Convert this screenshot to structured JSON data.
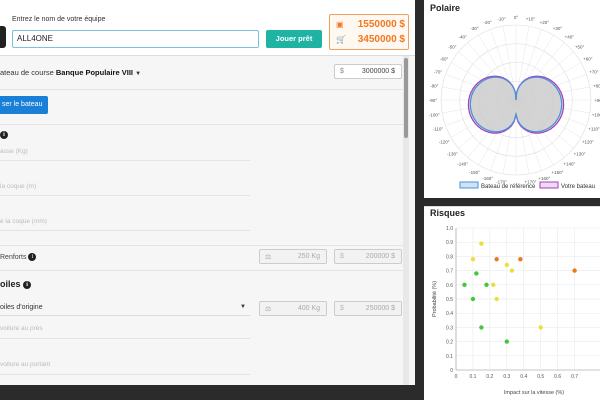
{
  "header": {
    "team_label": "Entrez le nom de votre équipe",
    "team_value": "ALL4ONE",
    "play_label": "Jouer prêt",
    "money_total": "1550000 $",
    "money_cart": "3450000 $"
  },
  "boat": {
    "label_prefix": "ateau de course",
    "label_name": "Banque Populaire VIII",
    "price_unit": "$",
    "price_value": "3000000 $",
    "use_button": "ser le bateau"
  },
  "hull": {
    "fields": [
      "asse (Kg)",
      "la coque (m)",
      "e la coque (mm)"
    ],
    "reinforcements_label": "Renforts",
    "reinforcements_weight": "250 Kg",
    "reinforcements_unit": "$",
    "reinforcements_price": "200000 $"
  },
  "sails": {
    "title": "oiles",
    "select_value": "oiles d'origine",
    "weight": "400 Kg",
    "unit": "$",
    "price": "250000 $",
    "fields": [
      "voilure au près",
      "voilure au portant"
    ]
  },
  "polar": {
    "title": "Polaire",
    "legend_reference": "Bateau de référence",
    "legend_yours": "Votre bateau",
    "angle_labels": [
      "0°",
      "+10°",
      "+20°",
      "+30°",
      "+40°",
      "+50°",
      "+60°",
      "+70°",
      "+80°",
      "+90°",
      "+100°",
      "+110°",
      "+120°",
      "+130°",
      "+140°",
      "+150°",
      "+160°",
      "+170°",
      "-10°",
      "-20°",
      "-30°",
      "-40°",
      "-50°",
      "-60°",
      "-70°",
      "-80°",
      "-90°",
      "-100°",
      "-110°",
      "-120°",
      "-130°",
      "-140°",
      "-150°",
      "-160°",
      "-170°"
    ],
    "colors": {
      "reference": "#4a90d9",
      "yours": "#a040c0"
    }
  },
  "risks": {
    "title": "Risques",
    "xlabel": "Impact sur la vitesse (%)",
    "ylabel": "Probabilité (%)"
  },
  "chart_data": {
    "type": "scatter",
    "title": "Risques",
    "xlabel": "Impact sur la vitesse (%)",
    "ylabel": "Probabilité (%)",
    "xlim": [
      0,
      0.8
    ],
    "ylim": [
      0,
      1.0
    ],
    "x_ticks": [
      "0",
      "0.1",
      "0.2",
      "0.3",
      "0.4",
      "0.5",
      "0.6",
      "0.7"
    ],
    "y_ticks": [
      "0",
      "0.1",
      "0.2",
      "0.3",
      "0.4",
      "0.5",
      "0.6",
      "0.7",
      "0.8",
      "0.9",
      "1.0"
    ],
    "points": [
      {
        "x": 0.15,
        "y": 0.89,
        "c": "#e8e040"
      },
      {
        "x": 0.1,
        "y": 0.78,
        "c": "#e8e040"
      },
      {
        "x": 0.24,
        "y": 0.78,
        "c": "#e87a20"
      },
      {
        "x": 0.38,
        "y": 0.78,
        "c": "#e87a20"
      },
      {
        "x": 0.3,
        "y": 0.74,
        "c": "#e8e040"
      },
      {
        "x": 0.33,
        "y": 0.7,
        "c": "#e8e040"
      },
      {
        "x": 0.7,
        "y": 0.7,
        "c": "#e87a20"
      },
      {
        "x": 0.12,
        "y": 0.68,
        "c": "#40c840"
      },
      {
        "x": 0.22,
        "y": 0.6,
        "c": "#e8e040"
      },
      {
        "x": 0.05,
        "y": 0.6,
        "c": "#40c840"
      },
      {
        "x": 0.18,
        "y": 0.6,
        "c": "#40c840"
      },
      {
        "x": 0.1,
        "y": 0.5,
        "c": "#40c840"
      },
      {
        "x": 0.24,
        "y": 0.5,
        "c": "#e8e040"
      },
      {
        "x": 0.15,
        "y": 0.3,
        "c": "#40c840"
      },
      {
        "x": 0.5,
        "y": 0.3,
        "c": "#e8e040"
      },
      {
        "x": 0.3,
        "y": 0.2,
        "c": "#40c840"
      }
    ]
  }
}
